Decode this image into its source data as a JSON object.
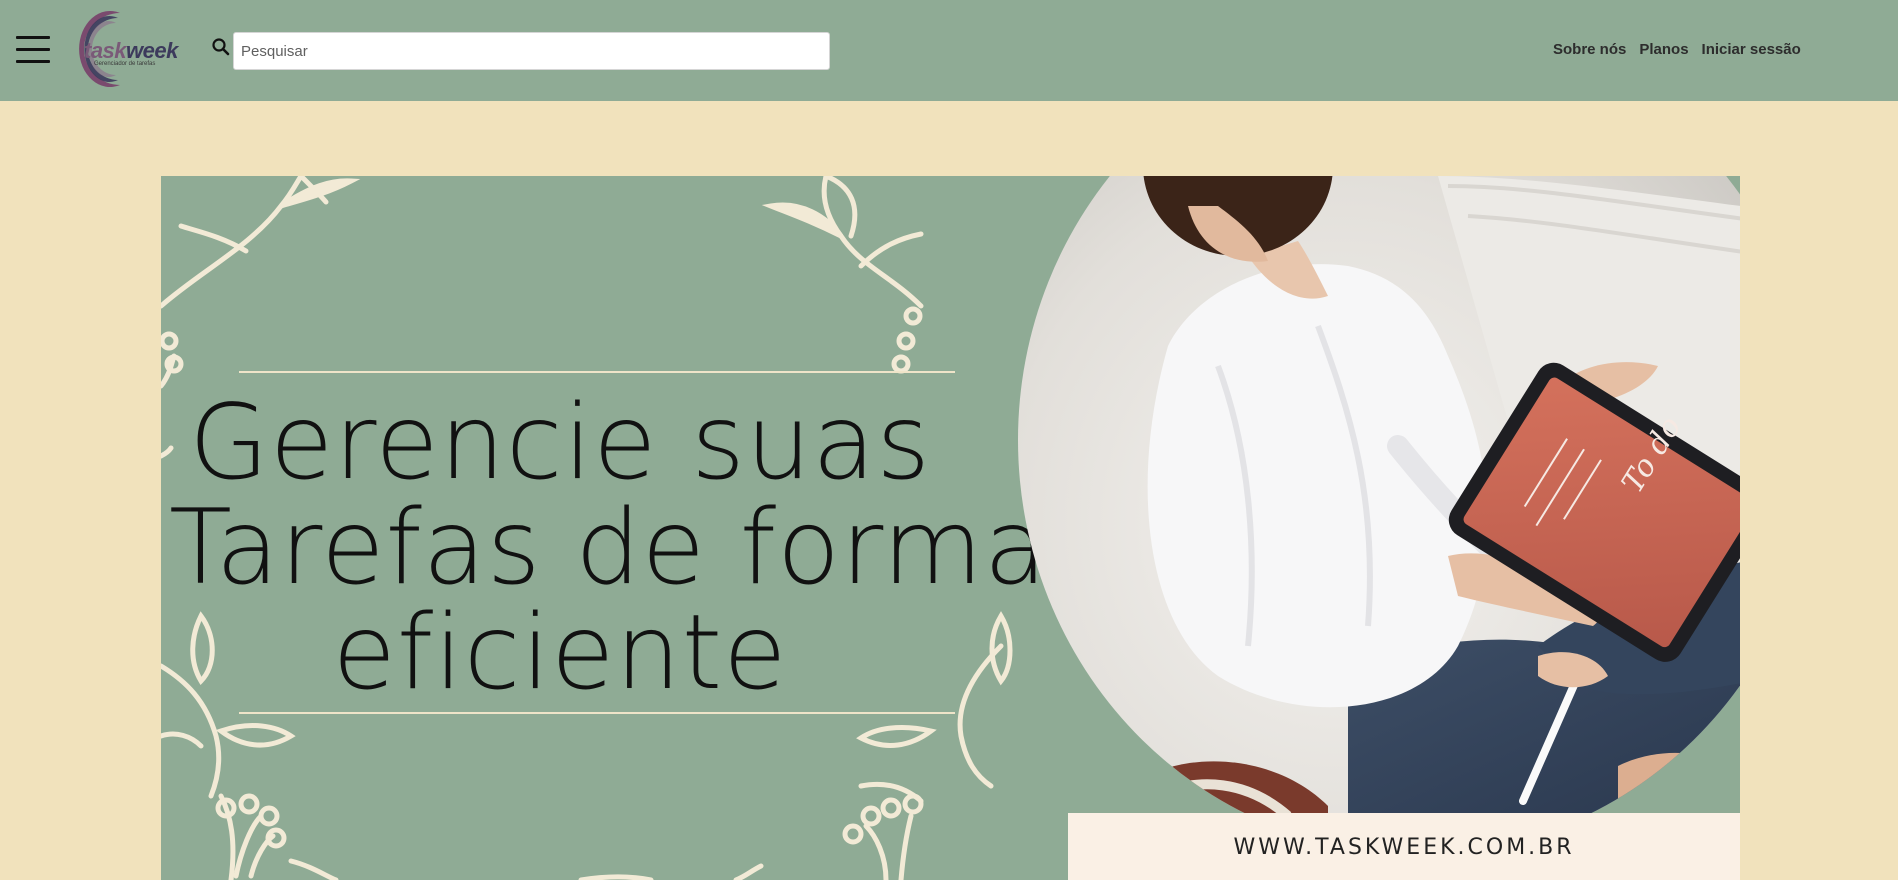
{
  "header": {
    "logo": {
      "word_a": "task",
      "word_b": "week",
      "tagline": "Gerenciador de tarefas"
    },
    "search": {
      "placeholder": "Pesquisar",
      "value": ""
    },
    "nav": [
      {
        "label": "Sobre nós"
      },
      {
        "label": "Planos"
      },
      {
        "label": "Iniciar sessão"
      }
    ]
  },
  "banner": {
    "headline_lines": [
      "Gerencie suas",
      "Tarefas de forma",
      "eficiente"
    ],
    "url": "WWW.TASKWEEK.COM.BR",
    "tablet_text": "To do"
  },
  "colors": {
    "header_bg": "#8fab95",
    "page_bg": "#f1e2bc",
    "banner_bg": "#8fab95",
    "ornament": "#f2ead6",
    "tablet_screen": "#c96a55"
  },
  "icons": [
    "hamburger-menu-icon",
    "taskweek-logo",
    "search-icon"
  ]
}
